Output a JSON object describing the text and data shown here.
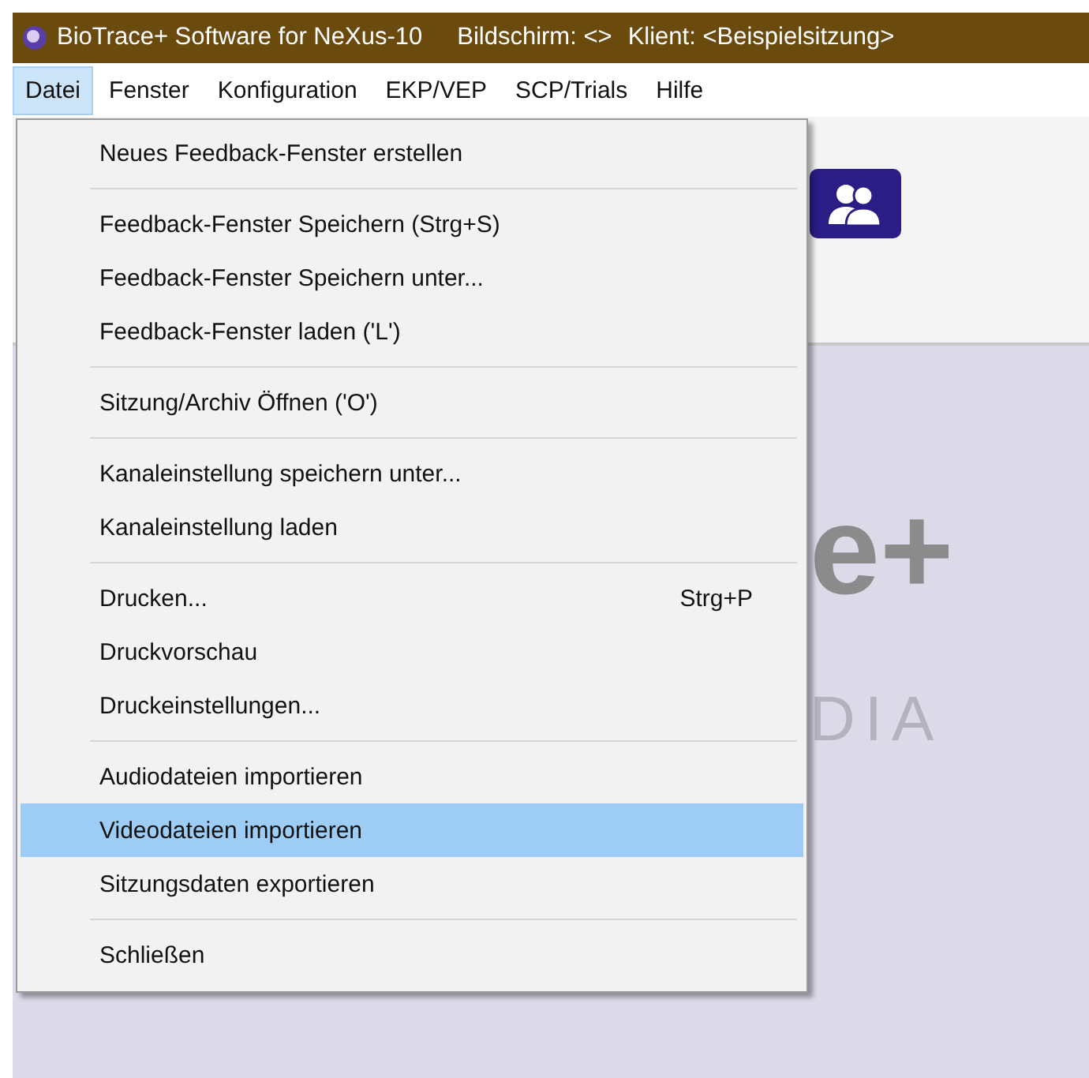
{
  "window": {
    "title": "BioTrace+ Software for NeXus-10",
    "screen_label": "Bildschirm: <>",
    "client_label": "Klient: <Beispielsitzung>"
  },
  "menubar": [
    {
      "label": "Datei",
      "selected": true
    },
    {
      "label": "Fenster",
      "selected": false
    },
    {
      "label": "Konfiguration",
      "selected": false
    },
    {
      "label": "EKP/VEP",
      "selected": false
    },
    {
      "label": "SCP/Trials",
      "selected": false
    },
    {
      "label": "Hilfe",
      "selected": false
    }
  ],
  "background": {
    "logo_text": "e+",
    "logo_subtext": "DIA"
  },
  "menu": {
    "groups": [
      [
        {
          "label": "Neues Feedback-Fenster erstellen",
          "selected": false
        }
      ],
      [
        {
          "label": "Feedback-Fenster Speichern (Strg+S)",
          "selected": false
        },
        {
          "label": "Feedback-Fenster Speichern unter...",
          "selected": false
        },
        {
          "label": "Feedback-Fenster laden ('L')",
          "selected": false
        }
      ],
      [
        {
          "label": "Sitzung/Archiv Öffnen ('O')",
          "selected": false
        }
      ],
      [
        {
          "label": "Kanaleinstellung speichern unter...",
          "selected": false
        },
        {
          "label": "Kanaleinstellung laden",
          "selected": false
        }
      ],
      [
        {
          "label": "Drucken...",
          "shortcut": "Strg+P",
          "selected": false
        },
        {
          "label": "Druckvorschau",
          "selected": false
        },
        {
          "label": "Druckeinstellungen...",
          "selected": false
        }
      ],
      [
        {
          "label": "Audiodateien importieren",
          "selected": false
        },
        {
          "label": "Videodateien importieren",
          "selected": true
        },
        {
          "label": "Sitzungsdaten exportieren",
          "selected": false
        }
      ],
      [
        {
          "label": "Schließen",
          "selected": false
        }
      ]
    ]
  }
}
